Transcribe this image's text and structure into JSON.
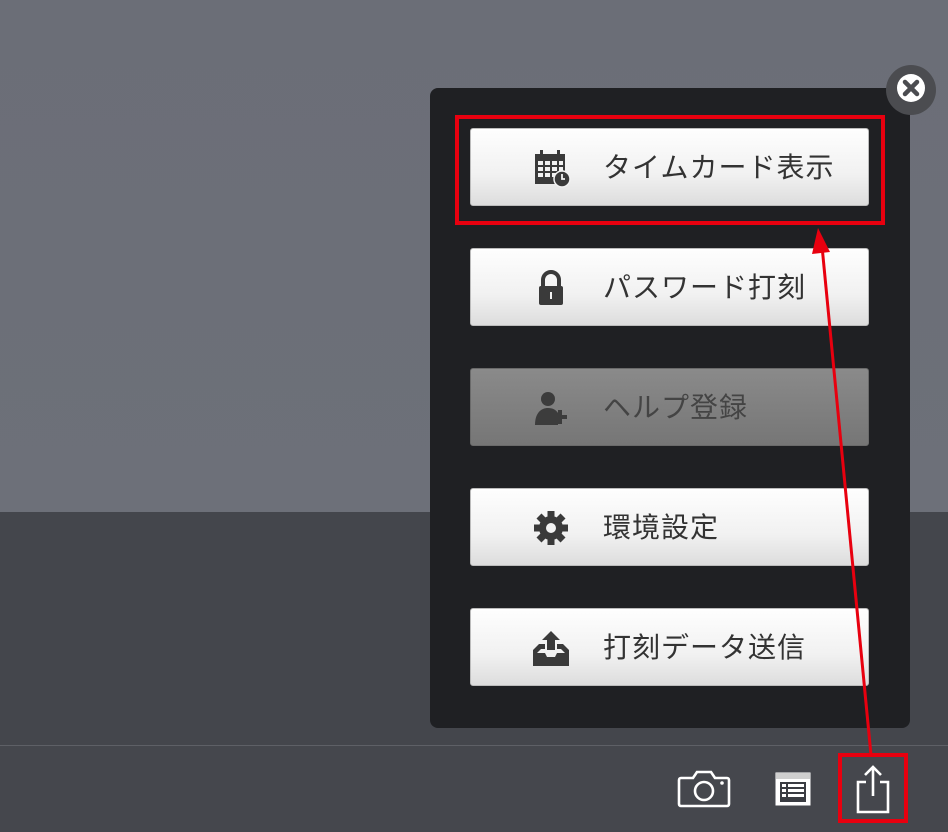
{
  "menu": {
    "close_icon": "close-icon",
    "items": [
      {
        "label": "タイムカード表示",
        "icon": "calendar-clock-icon",
        "enabled": true
      },
      {
        "label": "パスワード打刻",
        "icon": "lock-icon",
        "enabled": true
      },
      {
        "label": "ヘルプ登録",
        "icon": "add-user-icon",
        "enabled": false
      },
      {
        "label": "環境設定",
        "icon": "gear-icon",
        "enabled": true
      },
      {
        "label": "打刻データ送信",
        "icon": "upload-tray-icon",
        "enabled": true
      }
    ]
  },
  "toolbar": {
    "icons": [
      "camera-icon",
      "list-icon",
      "share-icon"
    ]
  },
  "annotations": {
    "color": "#e8000f"
  }
}
